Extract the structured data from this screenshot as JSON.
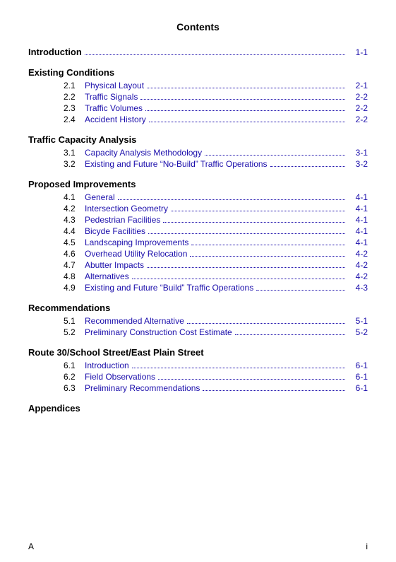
{
  "title": "Contents",
  "sections": [
    {
      "type": "section",
      "heading": null,
      "entries": [
        {
          "number": "Introduction",
          "label": "",
          "page": "1-1",
          "isHeading": true,
          "indent": false
        }
      ]
    },
    {
      "type": "section",
      "heading": "Existing Conditions",
      "entries": [
        {
          "number": "2.1",
          "label": "Physical Layout",
          "page": "2-1"
        },
        {
          "number": "2.2",
          "label": "Traffic Signals",
          "page": "2-2"
        },
        {
          "number": "2.3",
          "label": "Traffic Volumes",
          "page": "2-2"
        },
        {
          "number": "2.4",
          "label": "Accident History",
          "page": "2-2"
        }
      ]
    },
    {
      "type": "section",
      "heading": "Traffic Capacity Analysis",
      "entries": [
        {
          "number": "3.1",
          "label": "Capacity Analysis Methodology",
          "page": "3-1"
        },
        {
          "number": "3.2",
          "label": "Existing and Future “No-Build” Traffic Operations",
          "page": "3-2"
        }
      ]
    },
    {
      "type": "section",
      "heading": "Proposed Improvements",
      "entries": [
        {
          "number": "4.1",
          "label": "General",
          "page": "4-1"
        },
        {
          "number": "4.2",
          "label": "Intersection Geometry",
          "page": "4-1"
        },
        {
          "number": "4.3",
          "label": "Pedestrian Facilities",
          "page": "4-1"
        },
        {
          "number": "4.4",
          "label": "Bicyde Facilities",
          "page": "4-1"
        },
        {
          "number": "4.5",
          "label": "Landscaping Improvements",
          "page": "4-1"
        },
        {
          "number": "4.6",
          "label": "Overhead Utility Relocation",
          "page": "4-2"
        },
        {
          "number": "4.7",
          "label": "Abutter Impacts",
          "page": "4-2"
        },
        {
          "number": "4.8",
          "label": "Alternatives",
          "page": "4-2"
        },
        {
          "number": "4.9",
          "label": "Existing and Future “Build” Traffic Operations",
          "page": "4-3"
        }
      ]
    },
    {
      "type": "section",
      "heading": "Recommendations",
      "entries": [
        {
          "number": "5.1",
          "label": "Recommended Alternative",
          "page": "5-1"
        },
        {
          "number": "5.2",
          "label": "Preliminary Construction Cost Estimate",
          "page": "5-2"
        }
      ]
    },
    {
      "type": "section",
      "heading": "Route 30/School Street/East Plain Street",
      "entries": [
        {
          "number": "6.1",
          "label": "Introduction",
          "page": "6-1"
        },
        {
          "number": "6.2",
          "label": "Field Observations",
          "page": "6-1"
        },
        {
          "number": "6.3",
          "label": "Preliminary Recommendations",
          "page": "6-1"
        }
      ]
    },
    {
      "type": "section",
      "heading": "Appendices",
      "entries": []
    }
  ],
  "footer": {
    "left": "A",
    "right": "i"
  }
}
